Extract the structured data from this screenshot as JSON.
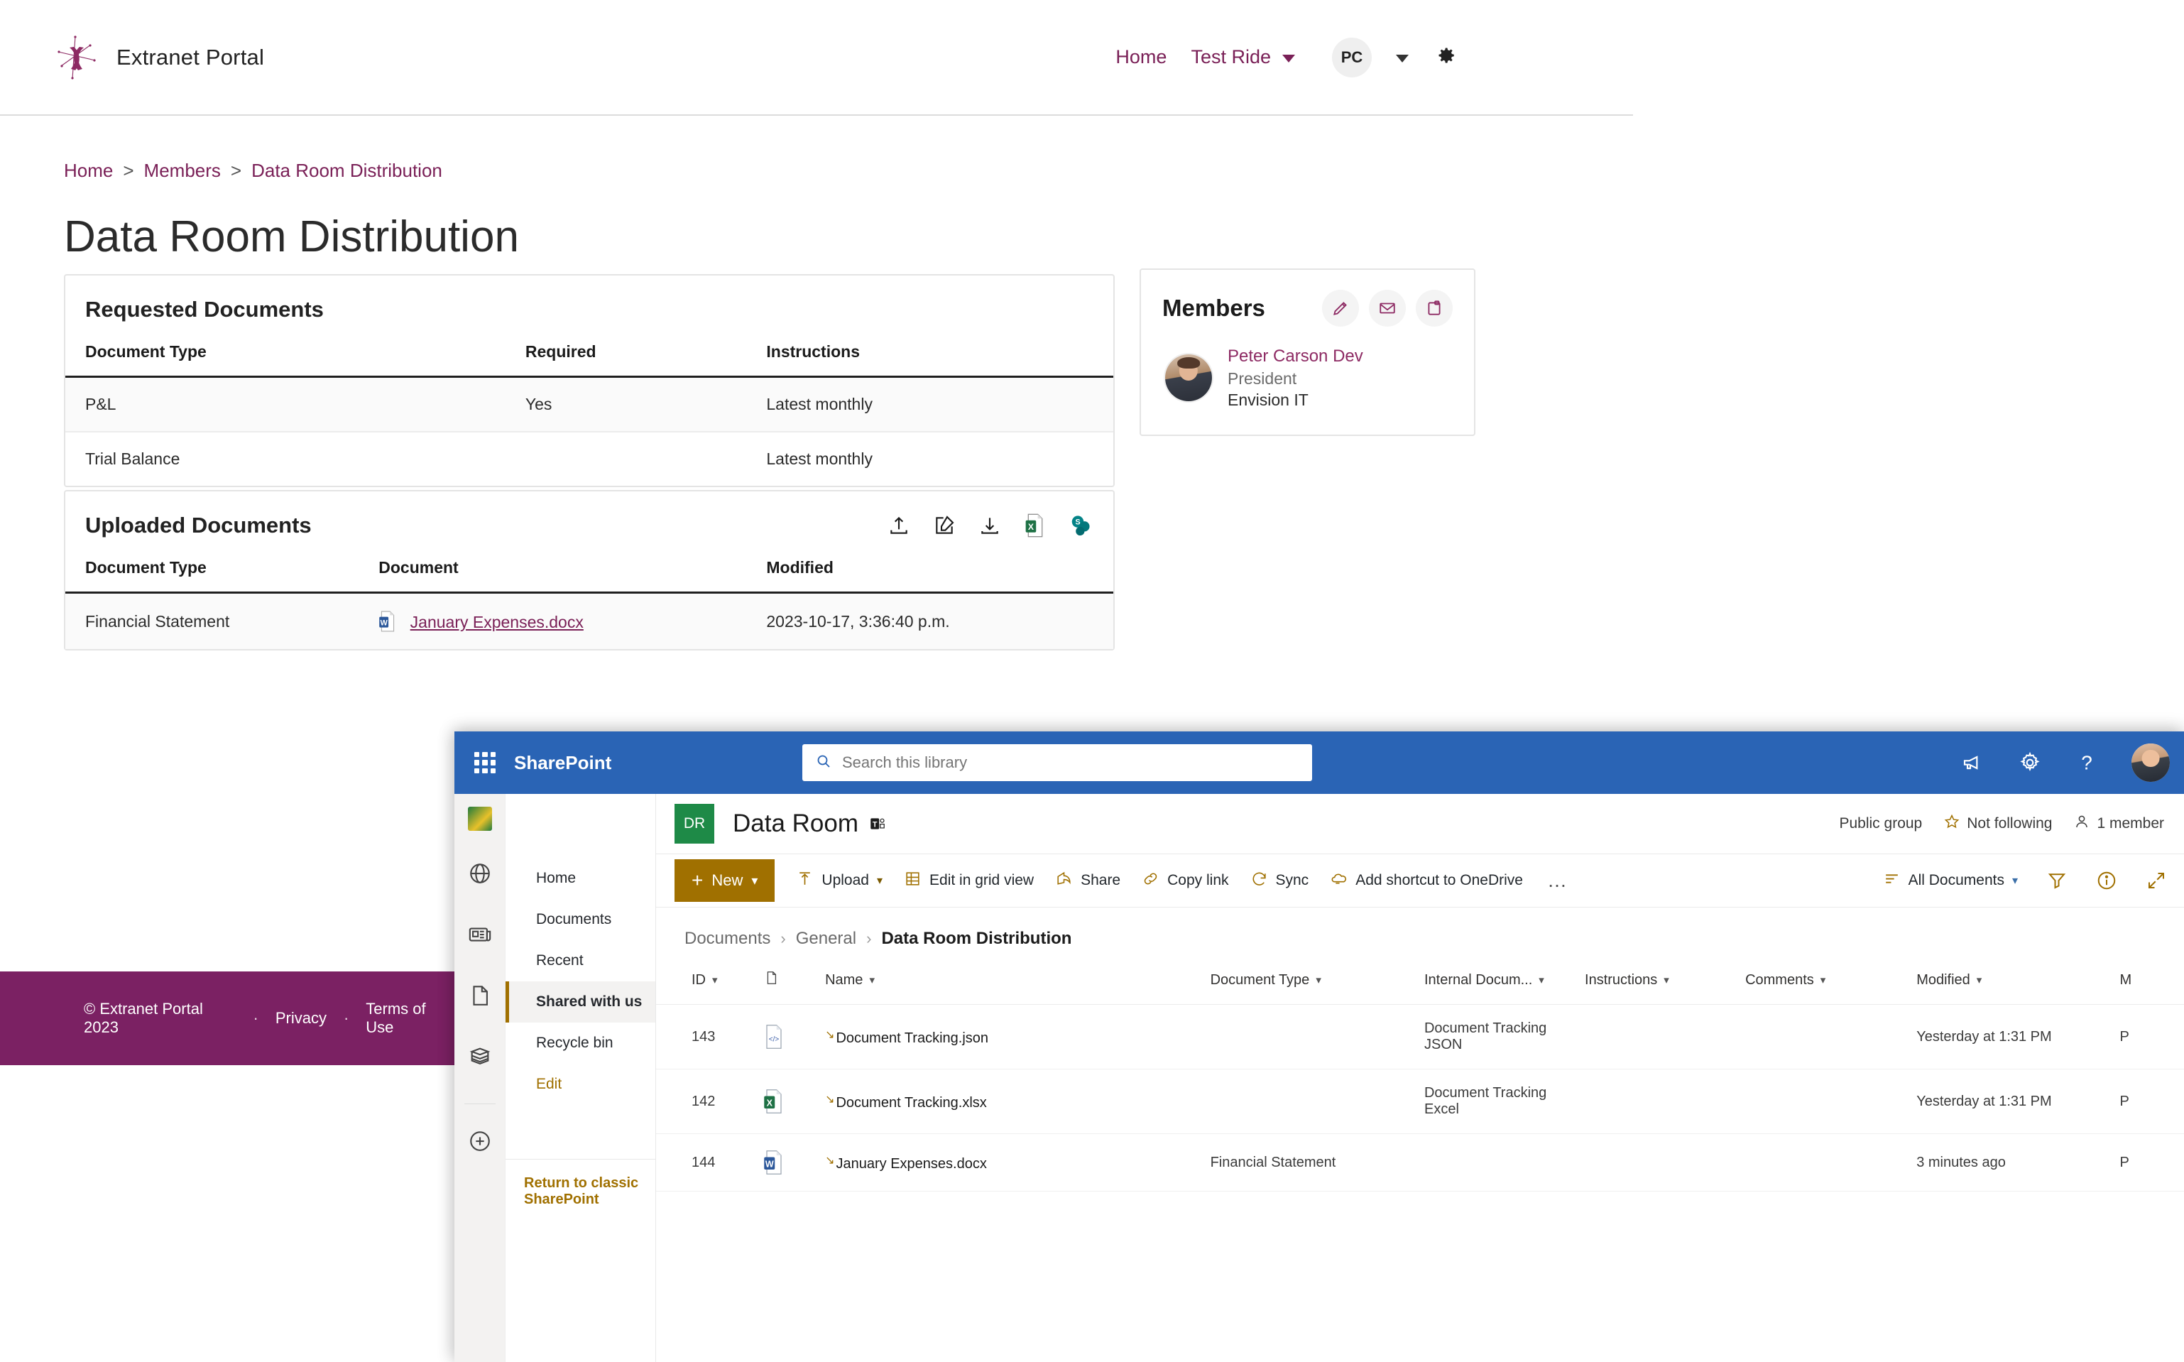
{
  "portal": {
    "brand": {
      "title": "Extranet Portal",
      "logo_icon": "asterisk-star-logo"
    },
    "nav": {
      "home": "Home",
      "test_ride": "Test Ride",
      "avatar_initials": "PC",
      "gear_icon": "gear-icon"
    },
    "breadcrumb": {
      "home": "Home",
      "members": "Members",
      "current": "Data Room Distribution",
      "separator": ">"
    },
    "page_title": "Data Room Distribution",
    "requested": {
      "title": "Requested Documents",
      "columns": [
        "Document Type",
        "Required",
        "Instructions"
      ],
      "rows": [
        {
          "type": "P&L",
          "required": "Yes",
          "instructions": "Latest monthly"
        },
        {
          "type": "Trial Balance",
          "required": "",
          "instructions": "Latest monthly"
        }
      ]
    },
    "members": {
      "title": "Members",
      "actions": [
        "edit-pencil-icon",
        "mail-envelope-icon",
        "clipboard-icon"
      ],
      "person": {
        "name": "Peter Carson Dev",
        "role": "President",
        "org": "Envision IT"
      }
    },
    "uploaded": {
      "title": "Uploaded Documents",
      "tools": [
        "upload-icon",
        "edit-square-icon",
        "download-icon",
        "excel-export-icon",
        "sharepoint-icon"
      ],
      "columns": [
        "Document Type",
        "Document",
        "Modified"
      ],
      "rows": [
        {
          "type": "Financial Statement",
          "document": "January Expenses.docx",
          "doc_icon": "word-file-icon",
          "modified": "2023-10-17, 3:36:40 p.m."
        }
      ]
    },
    "footer": {
      "copyright": "© Extranet Portal 2023",
      "privacy": "Privacy",
      "terms": "Terms of Use",
      "dot": "·"
    }
  },
  "sharepoint": {
    "suite": {
      "waffle_icon": "app-launcher-waffle-icon",
      "brand": "SharePoint",
      "search_placeholder": "Search this library",
      "search_value": "",
      "search_icon": "search-icon",
      "icons": [
        "megaphone-icon",
        "settings-gear-icon",
        "help-question-icon"
      ],
      "user_avatar": "user-avatar"
    },
    "rail": {
      "logo": "envision-it-logo",
      "icons": [
        "globe-icon",
        "news-icon",
        "page-document-icon",
        "list-icon",
        "create-plus-icon"
      ]
    },
    "site": {
      "tile_initials": "DR",
      "name": "Data Room",
      "teams_icon": "teams-icon",
      "privacy": "Public group",
      "follow_label": "Not following",
      "follow_icon": "star-outline-icon",
      "members_label": "1 member",
      "members_icon": "person-icon"
    },
    "left_nav": {
      "items": [
        {
          "label": "Home",
          "selected": false
        },
        {
          "label": "Documents",
          "selected": false
        },
        {
          "label": "Recent",
          "selected": false
        },
        {
          "label": "Shared with us",
          "selected": true
        },
        {
          "label": "Recycle bin",
          "selected": false
        },
        {
          "label": "Edit",
          "selected": false,
          "style": "edit"
        }
      ],
      "classic_link": "Return to classic SharePoint"
    },
    "command_bar": {
      "new_label": "New",
      "new_icon": "plus-icon",
      "items": [
        {
          "label": "Upload",
          "icon": "upload-arrow-icon",
          "has_chevron": true
        },
        {
          "label": "Edit in grid view",
          "icon": "grid-icon",
          "has_chevron": false
        },
        {
          "label": "Share",
          "icon": "share-icon",
          "has_chevron": false
        },
        {
          "label": "Copy link",
          "icon": "link-icon",
          "has_chevron": false
        },
        {
          "label": "Sync",
          "icon": "sync-icon",
          "has_chevron": false
        },
        {
          "label": "Add shortcut to OneDrive",
          "icon": "onedrive-shortcut-icon",
          "has_chevron": false
        }
      ],
      "overflow": "…",
      "view_label": "All Documents",
      "view_icon": "view-lines-icon",
      "right_icons": [
        "filter-funnel-icon",
        "info-circle-icon",
        "expand-arrows-icon"
      ]
    },
    "breadcrumb": {
      "documents": "Documents",
      "general": "General",
      "current": "Data Room Distribution",
      "separator": "›"
    },
    "library": {
      "columns": [
        "ID",
        "",
        "Name",
        "Document Type",
        "Internal Docum...",
        "Instructions",
        "Comments",
        "Modified",
        "M"
      ],
      "rows": [
        {
          "id": "143",
          "icon": "json-file-icon",
          "name": "Document Tracking.json",
          "document_type": "",
          "internal_document": "Document Tracking JSON",
          "instructions": "",
          "comments": "",
          "modified": "Yesterday at 1:31 PM",
          "modified_by": "P"
        },
        {
          "id": "142",
          "icon": "excel-file-icon",
          "name": "Document Tracking.xlsx",
          "document_type": "",
          "internal_document": "Document Tracking Excel",
          "instructions": "",
          "comments": "",
          "modified": "Yesterday at 1:31 PM",
          "modified_by": "P"
        },
        {
          "id": "144",
          "icon": "word-file-icon",
          "name": "January Expenses.docx",
          "document_type": "Financial Statement",
          "internal_document": "",
          "instructions": "",
          "comments": "",
          "modified": "3 minutes ago",
          "modified_by": "P"
        }
      ]
    }
  },
  "colors": {
    "portal_accent": "#7a2057",
    "portal_footer": "#7b2163",
    "sharepoint_blue": "#2a64b5",
    "sharepoint_gold": "#a07000",
    "site_tile_green": "#1e8a47"
  }
}
